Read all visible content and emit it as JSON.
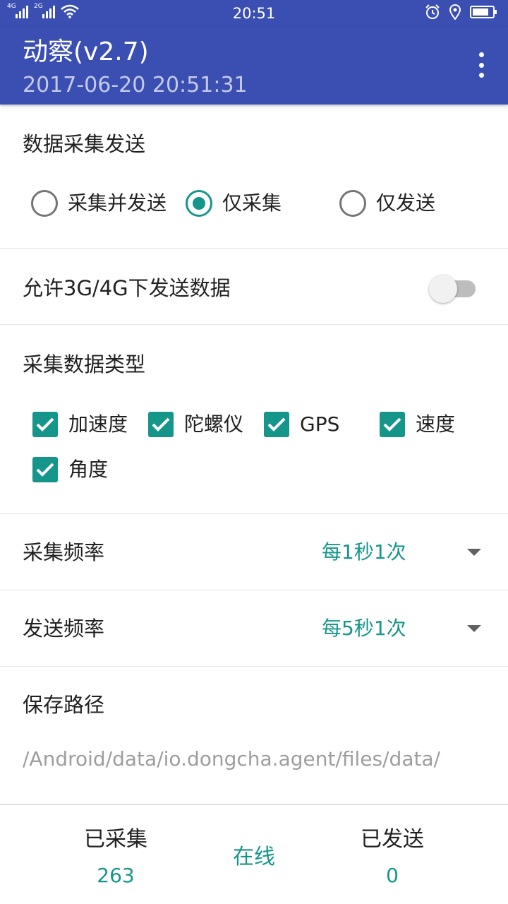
{
  "status_bar": {
    "network_1": "4G",
    "network_2": "2G",
    "time": "20:51"
  },
  "app_bar": {
    "title": "动察(v2.7)",
    "subtitle": "2017-06-20 20:51:31"
  },
  "collect_send": {
    "label": "数据采集发送",
    "options": [
      {
        "label": "采集并发送",
        "selected": false
      },
      {
        "label": "仅采集",
        "selected": true
      },
      {
        "label": "仅发送",
        "selected": false
      }
    ]
  },
  "mobile_data": {
    "label": "允许3G/4G下发送数据",
    "enabled": false
  },
  "data_types": {
    "label": "采集数据类型",
    "items": [
      {
        "label": "加速度",
        "checked": true
      },
      {
        "label": "陀螺仪",
        "checked": true
      },
      {
        "label": "GPS",
        "checked": true
      },
      {
        "label": "速度",
        "checked": true
      },
      {
        "label": "角度",
        "checked": true
      }
    ]
  },
  "collect_freq": {
    "label": "采集频率",
    "value": "每1秒1次"
  },
  "send_freq": {
    "label": "发送频率",
    "value": "每5秒1次"
  },
  "save_path": {
    "label": "保存路径",
    "value": "/Android/data/io.dongcha.agent/files/data/"
  },
  "footer": {
    "collected_label": "已采集",
    "collected_value": "263",
    "status": "在线",
    "sent_label": "已发送",
    "sent_value": "0"
  },
  "colors": {
    "primary": "#3b4fb3",
    "accent": "#16968a"
  }
}
